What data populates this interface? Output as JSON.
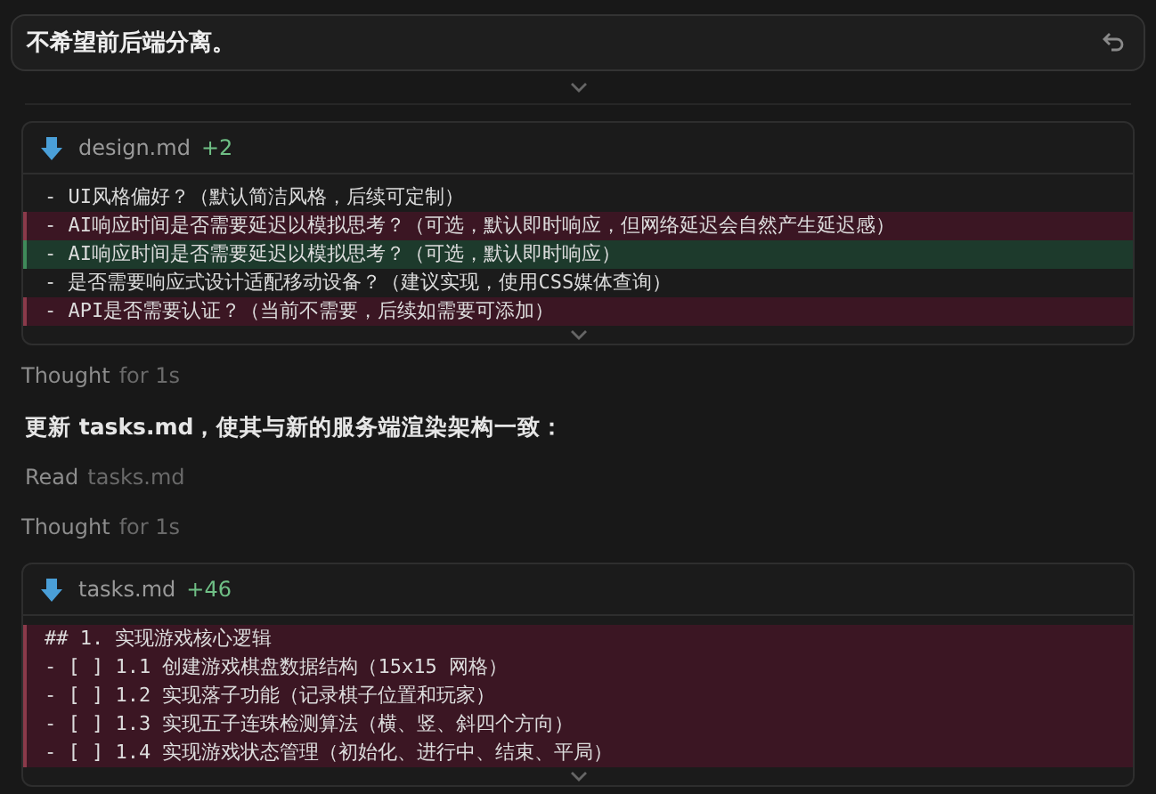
{
  "prompt": {
    "text": "不希望前后端分离。"
  },
  "blocks": [
    {
      "kind": "file",
      "name": "design.md",
      "delta": "+2",
      "lines": [
        {
          "kind": "context",
          "text": "- UI风格偏好？（默认简洁风格，后续可定制）"
        },
        {
          "kind": "removed",
          "text": "- AI响应时间是否需要延迟以模拟思考？（可选，默认即时响应，但网络延迟会自然产生延迟感）"
        },
        {
          "kind": "added",
          "text": "- AI响应时间是否需要延迟以模拟思考？（可选，默认即时响应）"
        },
        {
          "kind": "context",
          "text": "- 是否需要响应式设计适配移动设备？（建议实现，使用CSS媒体查询）"
        },
        {
          "kind": "removed",
          "text": "- API是否需要认证？（当前不需要，后续如需要可添加）"
        }
      ]
    },
    {
      "kind": "thought",
      "label": "Thought",
      "detail": "for 1s"
    },
    {
      "kind": "message",
      "text": "更新 tasks.md，使其与新的服务端渲染架构一致："
    },
    {
      "kind": "read",
      "label": "Read",
      "detail": "tasks.md"
    },
    {
      "kind": "thought",
      "label": "Thought",
      "detail": "for 1s"
    },
    {
      "kind": "file",
      "name": "tasks.md",
      "delta": "+46",
      "lines": [
        {
          "kind": "removed",
          "text": "## 1. 实现游戏核心逻辑"
        },
        {
          "kind": "removed",
          "text": "- [ ] 1.1 创建游戏棋盘数据结构（15x15 网格）"
        },
        {
          "kind": "removed",
          "text": "- [ ] 1.2 实现落子功能（记录棋子位置和玩家）"
        },
        {
          "kind": "removed",
          "text": "- [ ] 1.3 实现五子连珠检测算法（横、竖、斜四个方向）"
        },
        {
          "kind": "removed",
          "text": "- [ ] 1.4 实现游戏状态管理（初始化、进行中、结束、平局）"
        }
      ]
    }
  ]
}
